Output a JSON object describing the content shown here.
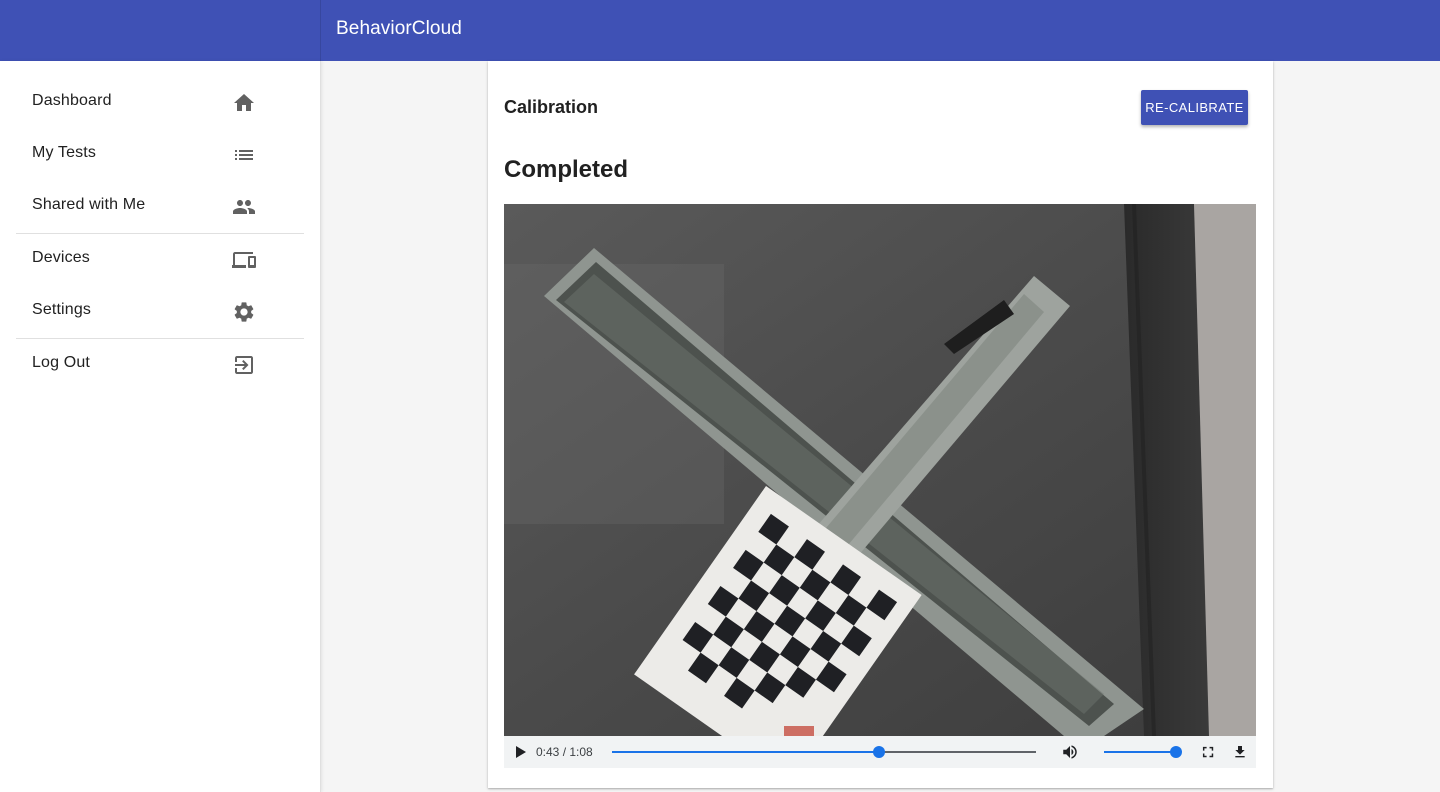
{
  "app": {
    "title": "BehaviorCloud"
  },
  "sidebar": {
    "items": [
      {
        "label": "Dashboard",
        "icon": "home-icon"
      },
      {
        "label": "My Tests",
        "icon": "list-icon"
      },
      {
        "label": "Shared with Me",
        "icon": "people-icon"
      },
      {
        "label": "Devices",
        "icon": "devices-icon"
      },
      {
        "label": "Settings",
        "icon": "gear-icon"
      },
      {
        "label": "Log Out",
        "icon": "exit-icon"
      }
    ]
  },
  "card": {
    "title": "Calibration",
    "button_label": "RE-CALIBRATE",
    "status": "Completed"
  },
  "video": {
    "current_time": "0:43",
    "duration": "1:08",
    "time_display": "0:43 / 1:08",
    "progress_fraction": 0.63,
    "volume_fraction": 1.0
  },
  "colors": {
    "primary": "#3f51b5",
    "accent_progress": "#1a73e8"
  }
}
